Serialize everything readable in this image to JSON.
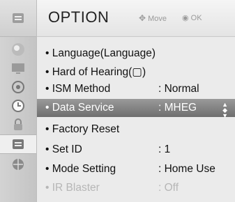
{
  "header": {
    "title": "OPTION",
    "hint_move": "Move",
    "hint_ok": "OK"
  },
  "menu": {
    "items": [
      {
        "label": "Language(Language)",
        "value": ""
      },
      {
        "label": "Hard of Hearing(▢)",
        "value": ""
      },
      {
        "label": "ISM Method",
        "value": ": Normal"
      },
      {
        "label": "Data Service",
        "value": ": MHEG"
      },
      {
        "label": "Factory Reset",
        "value": ""
      },
      {
        "label": "Set ID",
        "value": ": 1"
      },
      {
        "label": "Mode Setting",
        "value": ": Home Use"
      },
      {
        "label": "IR Blaster",
        "value": ": Off"
      }
    ]
  },
  "sidebar": {
    "icons": [
      "option-icon",
      "picture-icon",
      "screen-icon",
      "audio-icon",
      "time-icon",
      "lock-icon",
      "option-icon",
      "network-icon"
    ]
  },
  "colors": {
    "selected_row": "#7a7a7a",
    "background": "#ebebeb",
    "disabled_text": "#b6b6b6"
  }
}
